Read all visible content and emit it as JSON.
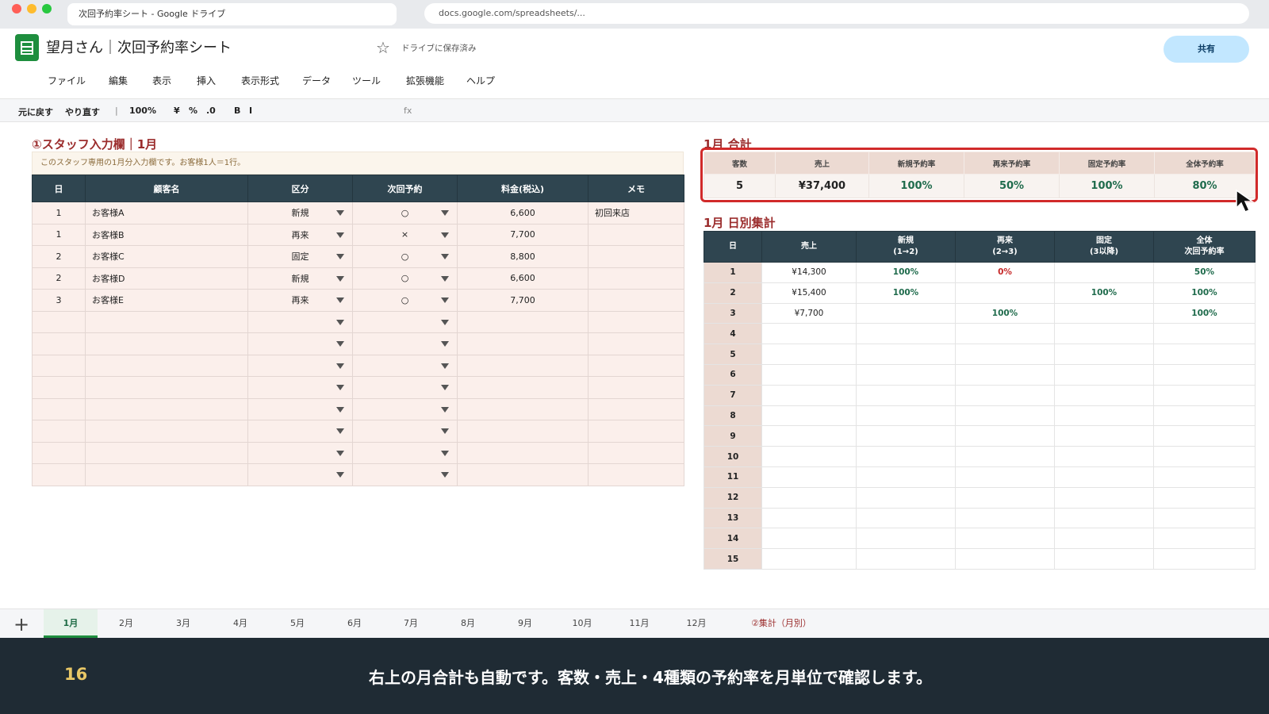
{
  "browser": {
    "tab_title": "次回予約率シート - Google ドライブ",
    "url": "docs.google.com/spreadsheets/..."
  },
  "sheet": {
    "title": "望月さん｜次回予約率シート",
    "saved_status": "ドライブに保存済み",
    "share_label": "共有"
  },
  "menu": [
    "ファイル",
    "編集",
    "表示",
    "挿入",
    "表示形式",
    "データ",
    "ツール",
    "拡張機能",
    "ヘルプ"
  ],
  "toolbar": {
    "undo": "元に戻す",
    "redo": "やり直す",
    "sep": "|",
    "zoom": "100%",
    "currency": "¥",
    "percent": "%",
    "decimal": ".0",
    "bold": "B",
    "italic": "I",
    "fx": "fx"
  },
  "staff_section": {
    "title": "①スタッフ入力欄｜1月",
    "note": "このスタッフ専用の1月分入力欄です。お客様1人＝1行。",
    "columns": [
      "日",
      "顧客名",
      "区分",
      "次回予約",
      "料金(税込)",
      "メモ"
    ],
    "rows": [
      {
        "day": "1",
        "name": "お客様A",
        "kubun": "新規",
        "next": "○",
        "fee": "6,600",
        "memo": "初回来店"
      },
      {
        "day": "1",
        "name": "お客様B",
        "kubun": "再来",
        "next": "×",
        "fee": "7,700",
        "memo": ""
      },
      {
        "day": "2",
        "name": "お客様C",
        "kubun": "固定",
        "next": "○",
        "fee": "8,800",
        "memo": ""
      },
      {
        "day": "2",
        "name": "お客様D",
        "kubun": "新規",
        "next": "○",
        "fee": "6,600",
        "memo": ""
      },
      {
        "day": "3",
        "name": "お客様E",
        "kubun": "再来",
        "next": "○",
        "fee": "7,700",
        "memo": ""
      },
      {
        "day": "",
        "name": "",
        "kubun": "",
        "next": "",
        "fee": "",
        "memo": ""
      },
      {
        "day": "",
        "name": "",
        "kubun": "",
        "next": "",
        "fee": "",
        "memo": ""
      },
      {
        "day": "",
        "name": "",
        "kubun": "",
        "next": "",
        "fee": "",
        "memo": ""
      },
      {
        "day": "",
        "name": "",
        "kubun": "",
        "next": "",
        "fee": "",
        "memo": ""
      },
      {
        "day": "",
        "name": "",
        "kubun": "",
        "next": "",
        "fee": "",
        "memo": ""
      },
      {
        "day": "",
        "name": "",
        "kubun": "",
        "next": "",
        "fee": "",
        "memo": ""
      },
      {
        "day": "",
        "name": "",
        "kubun": "",
        "next": "",
        "fee": "",
        "memo": ""
      },
      {
        "day": "",
        "name": "",
        "kubun": "",
        "next": "",
        "fee": "",
        "memo": ""
      }
    ]
  },
  "summary": {
    "title": "1月 合計",
    "columns": [
      "客数",
      "売上",
      "新規予約率",
      "再来予約率",
      "固定予約率",
      "全体予約率"
    ],
    "values": [
      "5",
      "¥37,400",
      "100%",
      "50%",
      "100%",
      "80%"
    ]
  },
  "daily": {
    "title": "1月 日別集計",
    "columns": [
      {
        "l1": "日",
        "l2": ""
      },
      {
        "l1": "売上",
        "l2": ""
      },
      {
        "l1": "新規",
        "l2": "(1→2)"
      },
      {
        "l1": "再来",
        "l2": "(2→3)"
      },
      {
        "l1": "固定",
        "l2": "(3以降)"
      },
      {
        "l1": "全体",
        "l2": "次回予約率"
      }
    ],
    "rows": [
      {
        "day": "1",
        "sales": "¥14,300",
        "new": "100%",
        "repeat": "0%",
        "fixed": "",
        "total": "50%"
      },
      {
        "day": "2",
        "sales": "¥15,400",
        "new": "100%",
        "repeat": "",
        "fixed": "100%",
        "total": "100%"
      },
      {
        "day": "3",
        "sales": "¥7,700",
        "new": "",
        "repeat": "100%",
        "fixed": "",
        "total": "100%"
      },
      {
        "day": "4",
        "sales": "",
        "new": "",
        "repeat": "",
        "fixed": "",
        "total": ""
      },
      {
        "day": "5",
        "sales": "",
        "new": "",
        "repeat": "",
        "fixed": "",
        "total": ""
      },
      {
        "day": "6",
        "sales": "",
        "new": "",
        "repeat": "",
        "fixed": "",
        "total": ""
      },
      {
        "day": "7",
        "sales": "",
        "new": "",
        "repeat": "",
        "fixed": "",
        "total": ""
      },
      {
        "day": "8",
        "sales": "",
        "new": "",
        "repeat": "",
        "fixed": "",
        "total": ""
      },
      {
        "day": "9",
        "sales": "",
        "new": "",
        "repeat": "",
        "fixed": "",
        "total": ""
      },
      {
        "day": "10",
        "sales": "",
        "new": "",
        "repeat": "",
        "fixed": "",
        "total": ""
      },
      {
        "day": "11",
        "sales": "",
        "new": "",
        "repeat": "",
        "fixed": "",
        "total": ""
      },
      {
        "day": "12",
        "sales": "",
        "new": "",
        "repeat": "",
        "fixed": "",
        "total": ""
      },
      {
        "day": "13",
        "sales": "",
        "new": "",
        "repeat": "",
        "fixed": "",
        "total": ""
      },
      {
        "day": "14",
        "sales": "",
        "new": "",
        "repeat": "",
        "fixed": "",
        "total": ""
      },
      {
        "day": "15",
        "sales": "",
        "new": "",
        "repeat": "",
        "fixed": "",
        "total": ""
      }
    ]
  },
  "sheet_tabs": [
    "1月",
    "2月",
    "3月",
    "4月",
    "5月",
    "6月",
    "7月",
    "8月",
    "9月",
    "10月",
    "11月",
    "12月",
    "②集計（月別）"
  ],
  "caption": {
    "step": "16",
    "text": "右上の月合計も自動です。客数・売上・4種類の予約率を月単位で確認します。"
  },
  "colors": {
    "header_dark": "#2f4550",
    "accent_red": "#9b2d2d",
    "highlight_red": "#d12a2a",
    "pct_green": "#1f6b4c",
    "sheets_green": "#1e8e3e"
  },
  "icons": [
    "sheets-logo-icon",
    "star-icon",
    "dropdown-caret-icon",
    "add-sheet-icon",
    "mouse-cursor-icon"
  ]
}
